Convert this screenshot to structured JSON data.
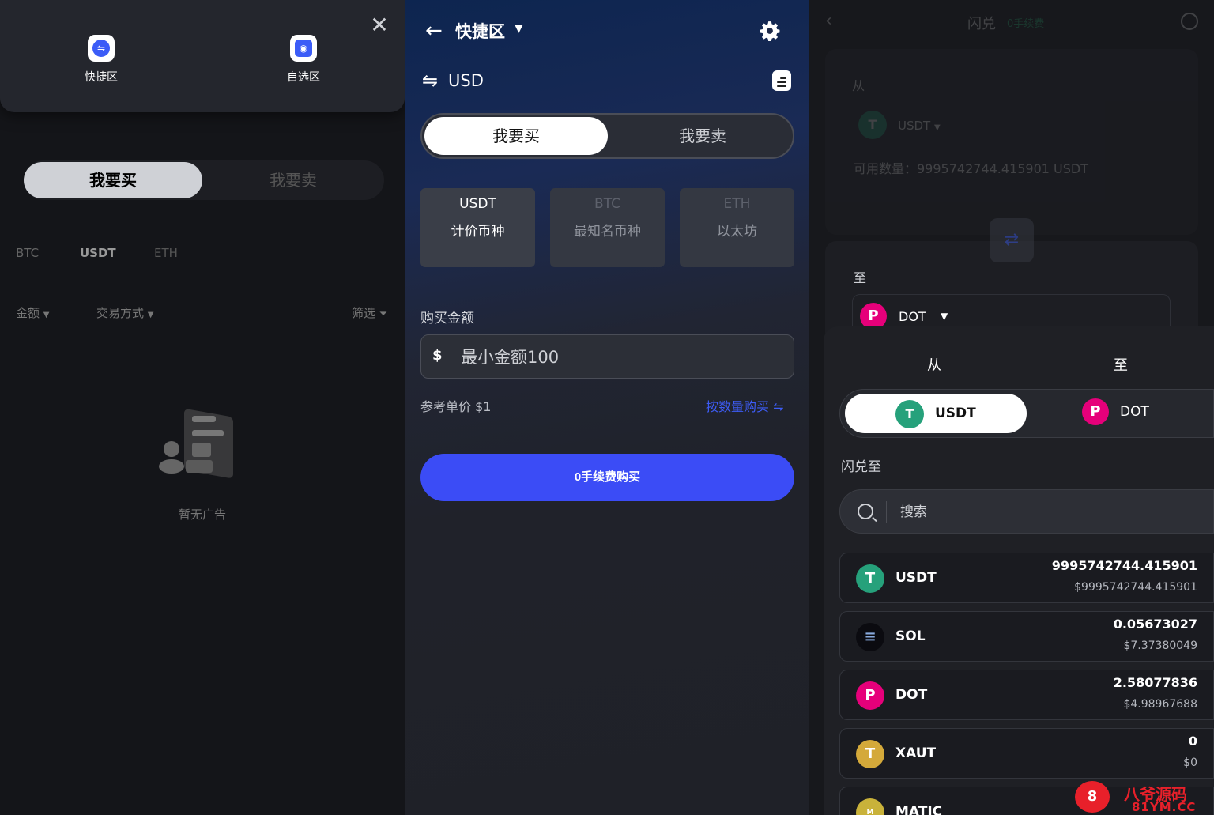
{
  "panel1": {
    "popup": {
      "items": [
        {
          "label": "快捷区",
          "icon": "quick-zone-icon"
        },
        {
          "label": "自选区",
          "icon": "bag-icon"
        }
      ],
      "close": "✕"
    },
    "segment": {
      "buy": "我要买",
      "sell": "我要卖"
    },
    "coin_tabs": [
      "BTC",
      "USDT",
      "ETH"
    ],
    "filters": {
      "amount": "金额",
      "method": "交易方式",
      "filter": "筛选"
    },
    "empty_text": "暂无广告"
  },
  "panel2": {
    "title": "快捷区",
    "currency": "USD",
    "segment": {
      "buy": "我要买",
      "sell": "我要卖"
    },
    "cards": [
      {
        "title": "USDT",
        "sub": "计价币种"
      },
      {
        "title": "BTC",
        "sub": "最知名币种"
      },
      {
        "title": "ETH",
        "sub": "以太坊"
      }
    ],
    "amount_label": "购买金额",
    "amount_symbol": "$",
    "amount_placeholder": "最小金额100",
    "ref_price": "参考单价 $1",
    "by_quantity": "按数量购买 ⇋",
    "buy_button": "0手续费购买",
    "accent": "#3b4cf6"
  },
  "panel3": {
    "title": "闪兑",
    "fee_badge": "0手续费",
    "from_label": "从",
    "from_coin": "USDT",
    "available": "可用数量：9995742744.415901 USDT",
    "to_label": "至",
    "to_coin": "DOT",
    "sheet": {
      "tab_from": "从",
      "tab_to": "至",
      "seg_from": "USDT",
      "seg_to": "DOT",
      "flash_to": "闪兑至",
      "search_placeholder": "搜索",
      "rows": [
        {
          "sym": "USDT",
          "bal": "9995742744.415901",
          "usd": "$9995742744.415901",
          "color": "#26a17b",
          "glyph": "T"
        },
        {
          "sym": "SOL",
          "bal": "0.05673027",
          "usd": "$7.37380049",
          "color": "#0b0b10",
          "glyph": "≡"
        },
        {
          "sym": "DOT",
          "bal": "2.58077836",
          "usd": "$4.98967688",
          "color": "#e6007a",
          "glyph": "P"
        },
        {
          "sym": "XAUT",
          "bal": "0",
          "usd": "$0",
          "color": "#d4a93a",
          "glyph": "T"
        },
        {
          "sym": "MATIC",
          "bal": "",
          "usd": "",
          "color": "#c9b23a",
          "glyph": "M"
        }
      ]
    }
  },
  "watermark": {
    "text1": "八爷源码",
    "text2": "81YM.CC"
  }
}
